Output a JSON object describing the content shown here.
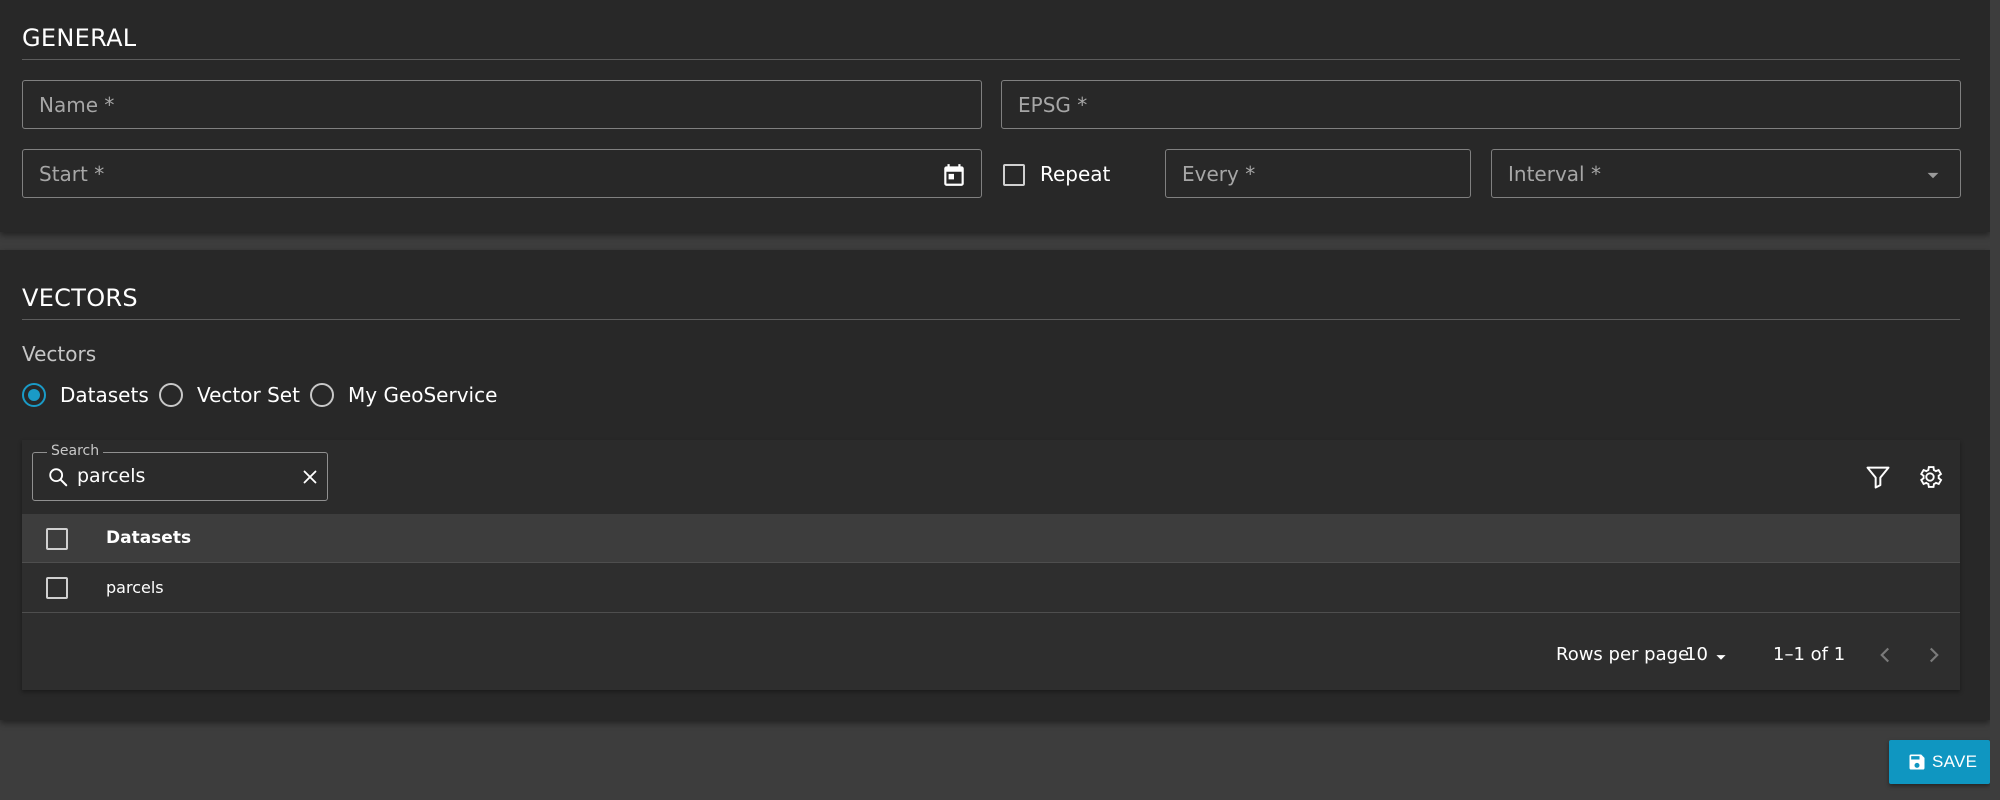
{
  "general": {
    "title": "GENERAL",
    "name_placeholder": "Name *",
    "epsg_placeholder": "EPSG *",
    "start_placeholder": "Start *",
    "repeat_label": "Repeat",
    "repeat_checked": false,
    "every_placeholder": "Every *",
    "interval_placeholder": "Interval *"
  },
  "vectors": {
    "title": "VECTORS",
    "group_label": "Vectors",
    "options": [
      {
        "label": "Datasets",
        "selected": true
      },
      {
        "label": "Vector Set",
        "selected": false
      },
      {
        "label": "My GeoService",
        "selected": false
      }
    ],
    "search": {
      "label": "Search",
      "value": "parcels"
    },
    "table": {
      "column_header": "Datasets",
      "rows": [
        {
          "name": "parcels",
          "checked": false
        }
      ]
    },
    "pagination": {
      "rows_per_page_label": "Rows per page",
      "rows_per_page_value": "10",
      "range_text": "1–1 of 1"
    }
  },
  "actions": {
    "save_label": "SAVE"
  },
  "colors": {
    "accent": "#1a9bc7",
    "panel": "#282828",
    "background": "#3d3d3d",
    "save_button": "#0f96c1"
  },
  "icons": {
    "start_trailing": "calendar-icon",
    "interval_trailing": "dropdown-arrow-icon",
    "search_leading": "search-icon",
    "search_trailing": "clear-icon",
    "toolbar": [
      "filter-icon",
      "settings-icon"
    ],
    "save": "floppy-disk-icon"
  }
}
